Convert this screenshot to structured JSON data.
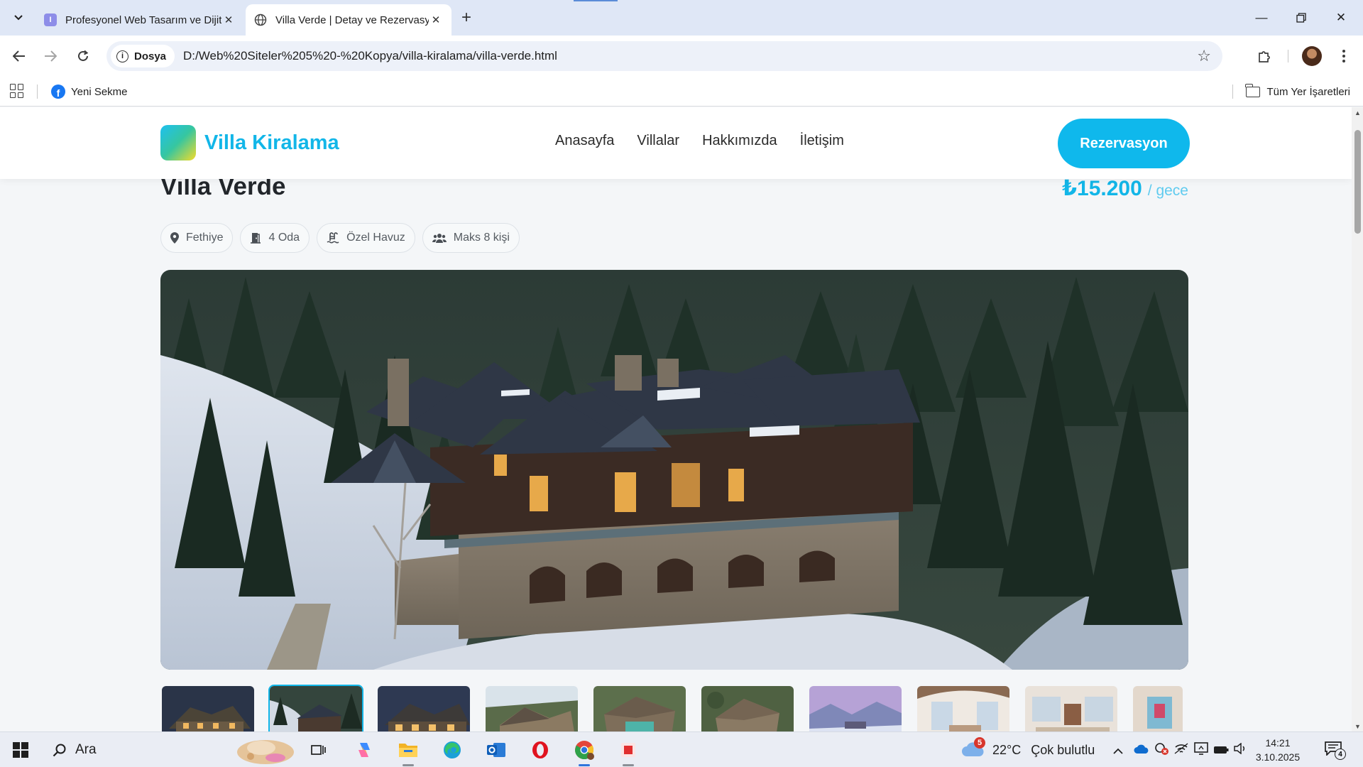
{
  "browser": {
    "tabs": [
      {
        "title": "Profesyonel Web Tasarım ve Dijital",
        "favicon": "I",
        "active": false
      },
      {
        "title": "Villa Verde | Detay ve Rezervasyon",
        "favicon": "globe-icon",
        "active": true
      }
    ],
    "new_tab": "+",
    "site_chip": "Dosya",
    "url": "D:/Web%20Siteler%205%20-%20Kopya/villa-kiralama/villa-verde.html",
    "bookmarks": [
      {
        "label": "Yeni Sekme",
        "icon": "facebook-icon"
      }
    ],
    "all_bookmarks": "Tüm Yer İşaretleri"
  },
  "site": {
    "logo_text": "Villa Kiralama",
    "nav": [
      "Anasayfa",
      "Villalar",
      "Hakkımızda",
      "İletişim"
    ],
    "cta": "Rezervasyon",
    "accent_color": "#12b6e8"
  },
  "villa": {
    "title": "Villa Verde",
    "price": "₺15.200",
    "price_unit": "/ gece",
    "features": [
      {
        "icon": "location-pin-icon",
        "label": "Fethiye"
      },
      {
        "icon": "door-icon",
        "label": "4 Oda"
      },
      {
        "icon": "pool-icon",
        "label": "Özel Havuz"
      },
      {
        "icon": "users-icon",
        "label": "Maks 8 kişi"
      }
    ],
    "thumbnail_count": 10,
    "selected_thumbnail": 2
  },
  "taskbar": {
    "search_placeholder": "Ara",
    "weather": {
      "temp": "22°C",
      "condition": "Çok bulutlu",
      "badge": "5"
    },
    "time": "14:21",
    "date": "3.10.2025",
    "notification_count": "4"
  }
}
